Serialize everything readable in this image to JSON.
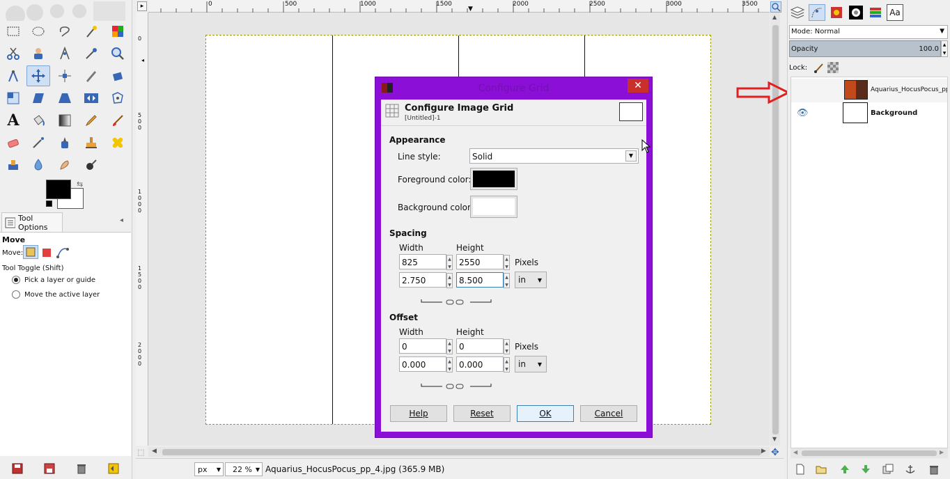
{
  "toolbox": {
    "tool_options_tab": "Tool Options",
    "move_heading": "Move",
    "move_label": "Move:",
    "tool_toggle": "Tool Toggle  (Shift)",
    "option_pick": "Pick a layer or guide",
    "option_move_active": "Move the active layer"
  },
  "ruler": {
    "top_ticks": [
      "0",
      "500",
      "1000",
      "1500",
      "2000",
      "2500",
      "3000",
      "3500"
    ],
    "left_ticks": [
      "0",
      "5\n0\n0",
      "1\n0\n0\n0",
      "1\n5\n0\n0",
      "2\n0\n0\n0"
    ]
  },
  "statusbar": {
    "unit": "px",
    "zoom": "22 %",
    "filename": "Aquarius_HocusPocus_pp_4.jpg (365.9 MB)"
  },
  "dialog": {
    "window_title": "Configure Grid",
    "close_glyph": "✕",
    "heading": "Configure Image Grid",
    "subheading": "[Untitled]-1",
    "appearance_heading": "Appearance",
    "line_style_label": "Line style:",
    "line_style_value": "Solid",
    "fg_color_label": "Foreground color:",
    "bg_color_label": "Background color:",
    "spacing_heading": "Spacing",
    "width_label": "Width",
    "height_label": "Height",
    "spacing_width_px": "825",
    "spacing_height_px": "2550",
    "pixels_label": "Pixels",
    "spacing_width_in": "2.750",
    "spacing_height_in": "8.500",
    "unit_in": "in",
    "offset_heading": "Offset",
    "offset_width_px": "0",
    "offset_height_px": "0",
    "offset_width_in": "0.000",
    "offset_height_in": "0.000",
    "help": "Help",
    "reset": "Reset",
    "ok": "OK",
    "cancel": "Cancel"
  },
  "layers": {
    "mode_label": "Mode: Normal",
    "opacity_label": "Opacity",
    "opacity_value": "100.0",
    "lock_label": "Lock:",
    "layer_top": "Aquarius_HocusPocus_pp",
    "layer_background": "Background"
  },
  "colors": {
    "dialog_frame": "#8b0fd6",
    "close_button": "#c9302c",
    "annotation_arrow": "#e02020",
    "foreground": "#000000",
    "background": "#ffffff"
  }
}
